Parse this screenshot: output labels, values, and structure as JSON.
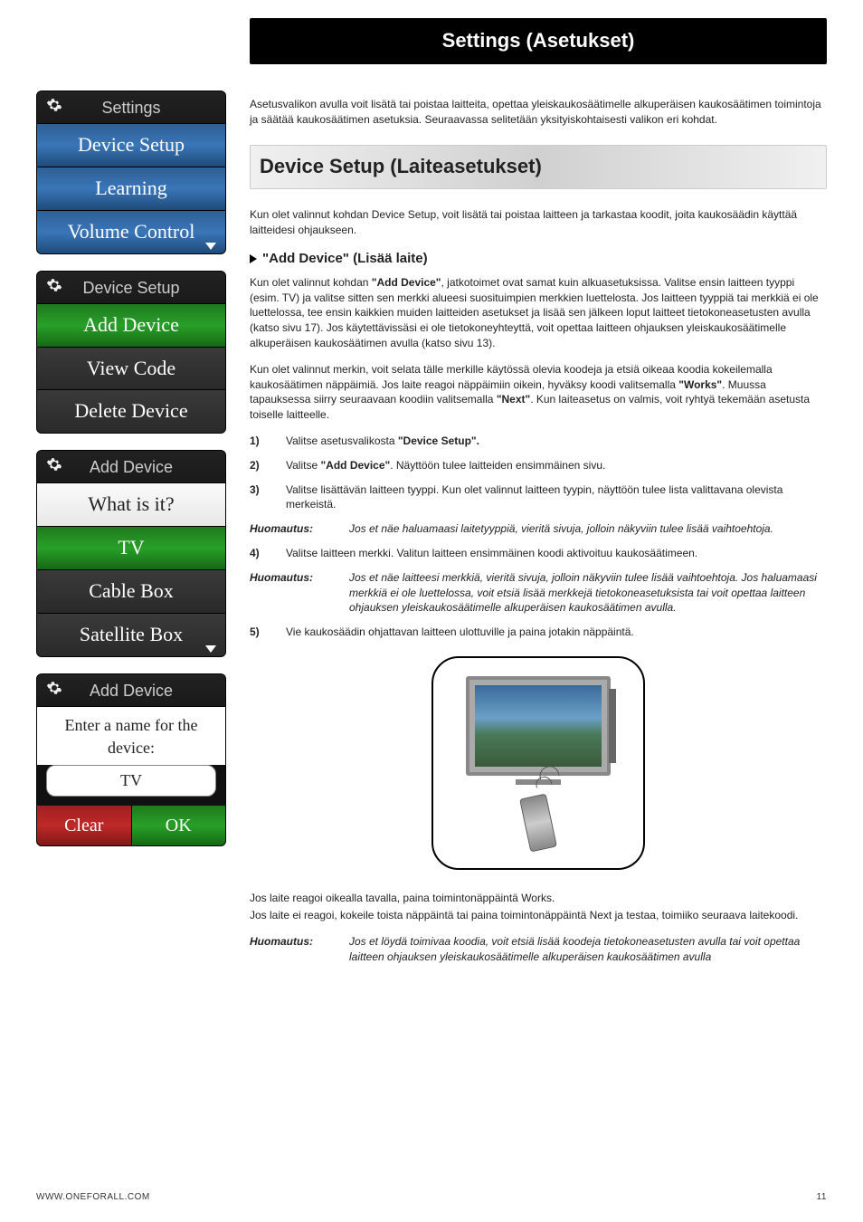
{
  "titleBar": "Settings (Asetukset)",
  "intro": "Asetusvalikon avulla voit lisätä tai poistaa laitteita, opettaa yleiskaukosäätimelle alkuperäisen kaukosäätimen toimintoja ja säätää kaukosäätimen asetuksia. Seuraavassa selitetään yksityiskohtaisesti valikon eri kohdat.",
  "sectionH": "Device Setup (Laiteasetukset)",
  "afterSection": "Kun olet valinnut kohdan Device Setup, voit lisätä tai poistaa laitteen ja tarkastaa koodit, joita kaukosäädin käyttää laitteidesi ohjaukseen.",
  "subH": "\"Add Device\" (Lisää laite)",
  "p1a": "Kun olet valinnut kohdan ",
  "p1b": "\"Add Device\"",
  "p1c": ", jatkotoimet ovat samat kuin alkuasetuksissa. Valitse ensin laitteen tyyppi (esim. TV) ja valitse sitten sen merkki alueesi suosituimpien merkkien luettelosta. Jos laitteen tyyppiä tai merkkiä ei ole luettelossa, tee ensin kaikkien muiden laitteiden asetukset ja lisää sen jälkeen loput laitteet tietokoneasetusten avulla (katso sivu 17). Jos käytettävissäsi ei ole tietokoneyhteyttä, voit opettaa laitteen ohjauksen yleiskaukosäätimelle alkuperäisen kaukosäätimen avulla (katso sivu 13).",
  "p2a": "Kun olet valinnut merkin, voit selata tälle merkille käytössä olevia koodeja ja etsiä oikeaa koodia kokeilemalla kaukosäätimen näppäimiä. Jos laite reagoi näppäimiin oikein, hyväksy koodi valitsemalla ",
  "p2b": "\"Works\"",
  "p2c": ". Muussa tapauksessa siirry seuraavaan koodiin valitsemalla ",
  "p2d": "\"Next\"",
  "p2e": ". Kun laiteasetus on valmis, voit ryhtyä tekemään asetusta toiselle laitteelle.",
  "steps": [
    {
      "n": "1)",
      "t_a": "Valitse asetusvalikosta ",
      "t_b": "\"Device Setup\"."
    },
    {
      "n": "2)",
      "t_a": "Valitse ",
      "t_b": "\"Add Device\"",
      "t_c": ". Näyttöön tulee laitteiden ensimmäinen sivu."
    },
    {
      "n": "3)",
      "t": "Valitse lisättävän laitteen tyyppi. Kun olet valinnut laitteen tyypin, näyttöön tulee lista valittavana olevista merkeistä."
    }
  ],
  "note1_lbl": "Huomautus:",
  "note1": "Jos et näe haluamaasi laitetyyppiä, vieritä sivuja, jolloin näkyviin tulee lisää vaihtoehtoja.",
  "step4": {
    "n": "4)",
    "t": "Valitse laitteen merkki. Valitun laitteen ensimmäinen koodi aktivoituu kaukosäätimeen."
  },
  "note2_lbl": "Huomautus:",
  "note2": "Jos et näe laitteesi merkkiä, vieritä sivuja, jolloin näkyviin tulee lisää vaihtoehtoja.  Jos haluamaasi merkkiä ei ole luettelossa, voit etsiä lisää merkkejä tietokoneasetuksista tai voit opettaa laitteen ohjauksen yleiskaukosäätimelle alkuperäisen kaukosäätimen avulla.",
  "step5": {
    "n": "5)",
    "t": "Vie kaukosäädin ohjattavan laitteen ulottuville ja paina jotakin näppäintä."
  },
  "afterIllu1": "Jos laite reagoi oikealla tavalla, paina toimintonäppäintä Works.",
  "afterIllu2": "Jos laite ei reagoi, kokeile toista näppäintä tai paina toimintonäppäintä Next ja testaa, toimiiko seuraava laitekoodi.",
  "note3_lbl": "Huomautus:",
  "note3": "Jos et löydä toimivaa koodia, voit etsiä lisää koodeja tietokoneasetusten avulla tai voit opettaa laitteen ohjauksen yleiskaukosäätimelle alkuperäisen kaukosäätimen avulla",
  "footer_left": "WWW.ONEFORALL.COM",
  "footer_right": "11",
  "panel1": {
    "header": "Settings",
    "rows": [
      "Device Setup",
      "Learning",
      "Volume Control"
    ]
  },
  "panel2": {
    "header": "Device Setup",
    "rows": [
      "Add Device",
      "View Code",
      "Delete Device"
    ]
  },
  "panel3": {
    "header": "Add Device",
    "rows": [
      "What is it?",
      "TV",
      "Cable Box",
      "Satellite Box"
    ]
  },
  "panel4": {
    "header": "Add Device",
    "label": "Enter a name for the device:",
    "value": "TV",
    "clear": "Clear",
    "ok": "OK"
  }
}
